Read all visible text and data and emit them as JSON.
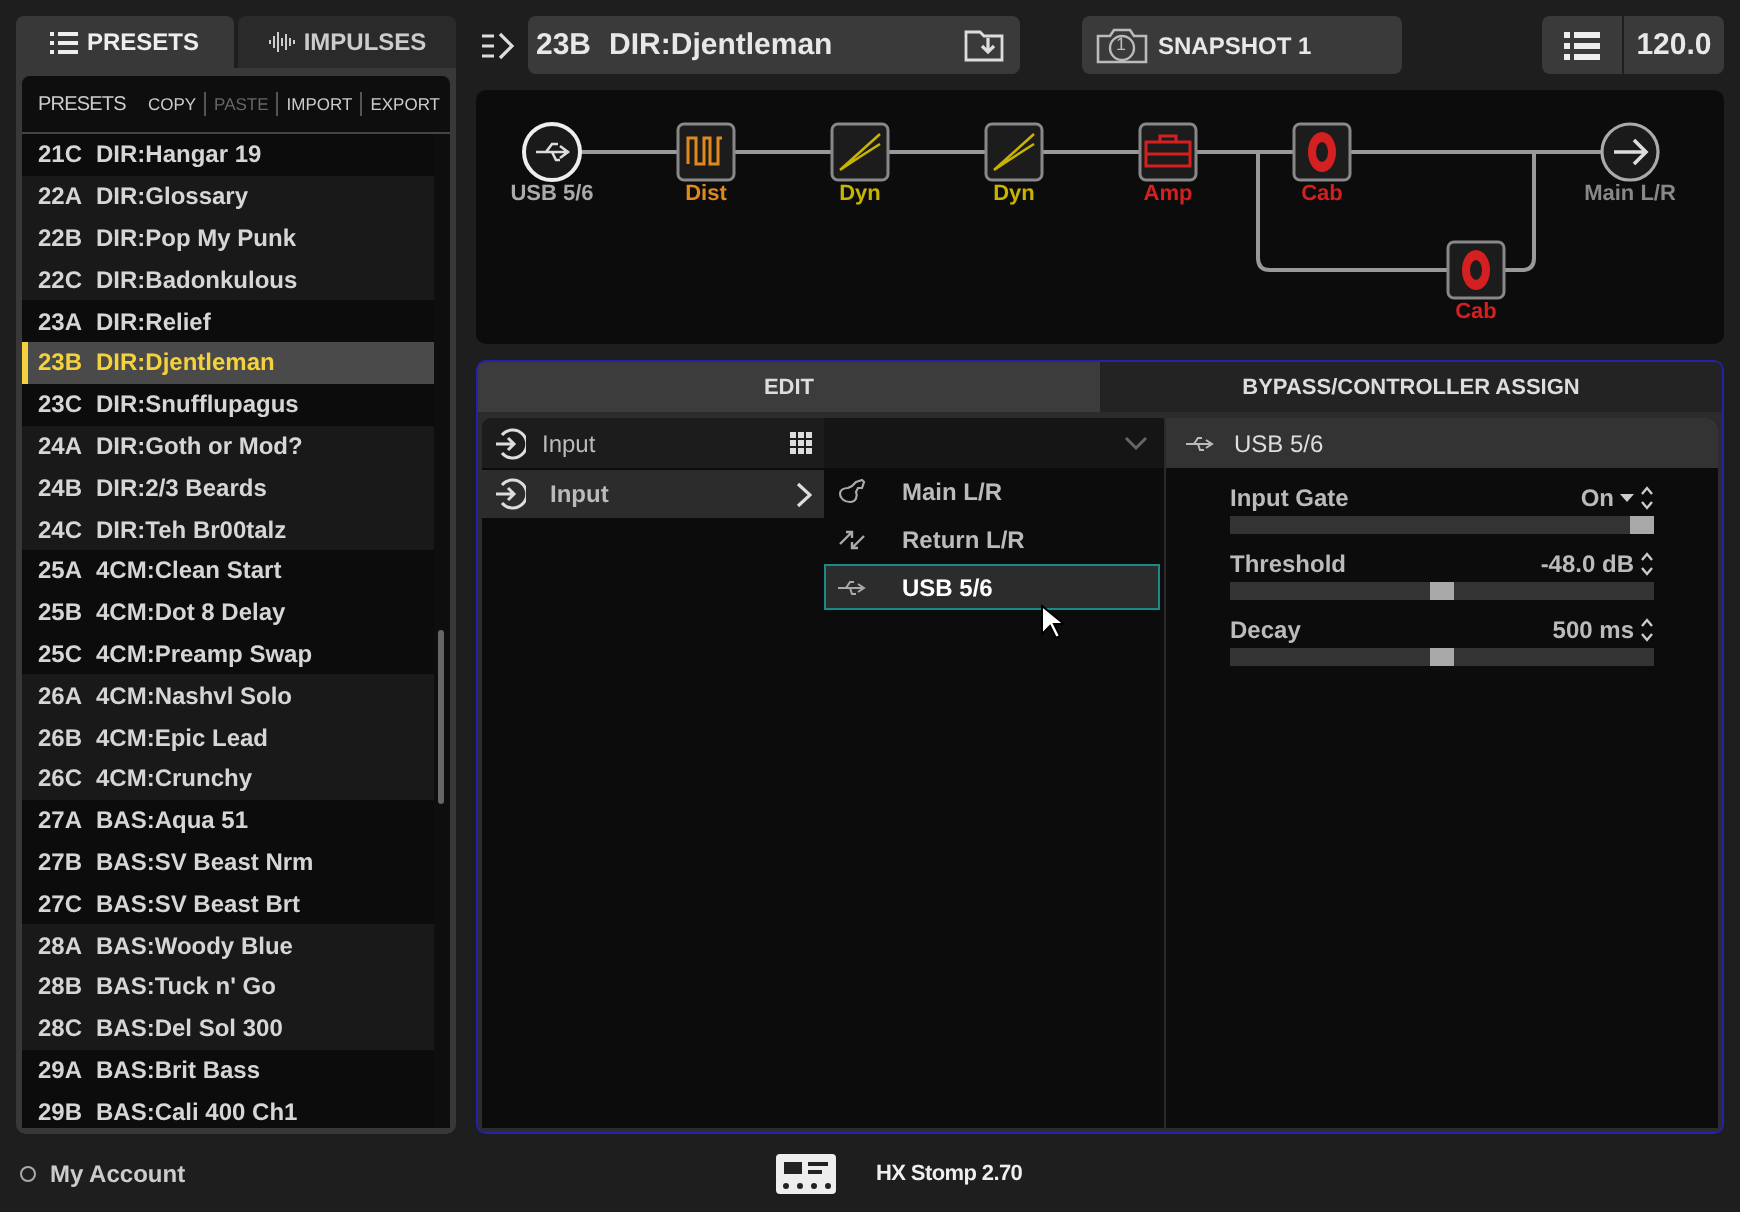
{
  "left_tabs": [
    {
      "label": "PRESETS",
      "kind": "list",
      "selected": true
    },
    {
      "label": "IMPULSES",
      "kind": "wave",
      "selected": false
    }
  ],
  "preset_toolbar": {
    "title": "PRESETS",
    "actions": [
      {
        "label": "COPY",
        "disabled": false
      },
      {
        "label": "PASTE",
        "disabled": true
      },
      {
        "label": "IMPORT",
        "disabled": false
      },
      {
        "label": "EXPORT",
        "disabled": false
      }
    ]
  },
  "banks": [
    {
      "presets": [
        {
          "number": "21C",
          "name": "DIR:Hangar 19",
          "selected": false
        }
      ]
    },
    {
      "presets": [
        {
          "number": "22A",
          "name": "DIR:Glossary",
          "selected": false
        },
        {
          "number": "22B",
          "name": "DIR:Pop My Punk",
          "selected": false
        },
        {
          "number": "22C",
          "name": "DIR:Badonkulous",
          "selected": false
        }
      ]
    },
    {
      "presets": [
        {
          "number": "23A",
          "name": "DIR:Relief",
          "selected": false
        },
        {
          "number": "23B",
          "name": "DIR:Djentleman",
          "selected": true
        },
        {
          "number": "23C",
          "name": "DIR:Snufflupagus",
          "selected": false
        }
      ]
    },
    {
      "presets": [
        {
          "number": "24A",
          "name": "DIR:Goth or Mod?",
          "selected": false
        },
        {
          "number": "24B",
          "name": "DIR:2/3 Beards",
          "selected": false
        },
        {
          "number": "24C",
          "name": "DIR:Teh Br00talz",
          "selected": false
        }
      ]
    },
    {
      "presets": [
        {
          "number": "25A",
          "name": "4CM:Clean Start",
          "selected": false
        },
        {
          "number": "25B",
          "name": "4CM:Dot 8 Delay",
          "selected": false
        },
        {
          "number": "25C",
          "name": "4CM:Preamp Swap",
          "selected": false
        }
      ]
    },
    {
      "presets": [
        {
          "number": "26A",
          "name": "4CM:Nashvl Solo",
          "selected": false
        },
        {
          "number": "26B",
          "name": "4CM:Epic Lead",
          "selected": false
        },
        {
          "number": "26C",
          "name": "4CM:Crunchy",
          "selected": false
        }
      ]
    },
    {
      "presets": [
        {
          "number": "27A",
          "name": "BAS:Aqua 51",
          "selected": false
        },
        {
          "number": "27B",
          "name": "BAS:SV Beast Nrm",
          "selected": false
        },
        {
          "number": "27C",
          "name": "BAS:SV Beast Brt",
          "selected": false
        }
      ]
    },
    {
      "presets": [
        {
          "number": "28A",
          "name": "BAS:Woody Blue",
          "selected": false
        },
        {
          "number": "28B",
          "name": "BAS:Tuck n' Go",
          "selected": false
        },
        {
          "number": "28C",
          "name": "BAS:Del Sol 300",
          "selected": false
        }
      ]
    },
    {
      "presets": [
        {
          "number": "29A",
          "name": "BAS:Brit Bass",
          "selected": false
        },
        {
          "number": "29B",
          "name": "BAS:Cali 400 Ch1",
          "selected": false
        }
      ]
    }
  ],
  "header": {
    "preset_number": "23B",
    "preset_name": "DIR:Djentleman",
    "snapshot": "SNAPSHOT 1",
    "snapshot_number": "1",
    "tempo": "120.0"
  },
  "chain": {
    "main": [
      {
        "label": "USB 5/6",
        "kind": "usb",
        "color": "#aaaaaa"
      },
      {
        "label": "Dist",
        "kind": "dist",
        "color": "#e08a1e"
      },
      {
        "label": "Dyn",
        "kind": "dyn",
        "color": "#c8b400"
      },
      {
        "label": "Dyn",
        "kind": "dyn",
        "color": "#c8b400"
      },
      {
        "label": "Amp",
        "kind": "amp",
        "color": "#d42020"
      },
      {
        "label": "Cab",
        "kind": "cab",
        "color": "#d42020"
      }
    ],
    "branch": [
      {
        "label": "Cab",
        "kind": "cab",
        "color": "#d42020"
      }
    ],
    "output": {
      "label": "Main L/R"
    }
  },
  "edit_tabs": [
    {
      "label": "EDIT",
      "selected": true
    },
    {
      "label": "BYPASS/CONTROLLER ASSIGN",
      "selected": false
    }
  ],
  "category_column": {
    "header": "Input",
    "items": [
      {
        "label": "Input",
        "selected": true
      }
    ]
  },
  "model_column": {
    "items": [
      {
        "label": "Main L/R",
        "kind": "guitar",
        "selected": false
      },
      {
        "label": "Return L/R",
        "kind": "return",
        "selected": false
      },
      {
        "label": "USB 5/6",
        "kind": "usb",
        "selected": true
      }
    ]
  },
  "params": {
    "title": "USB 5/6",
    "items": [
      {
        "name": "Input Gate",
        "value": "On",
        "dropdown": true,
        "level": 1
      },
      {
        "name": "Threshold",
        "value": "-48.0 dB",
        "dropdown": false,
        "level": 0.5
      },
      {
        "name": "Decay",
        "value": "500 ms",
        "dropdown": false,
        "level": 0.5
      }
    ]
  },
  "status_bar": {
    "account": "My Account",
    "device": "HX Stomp 2.70"
  }
}
